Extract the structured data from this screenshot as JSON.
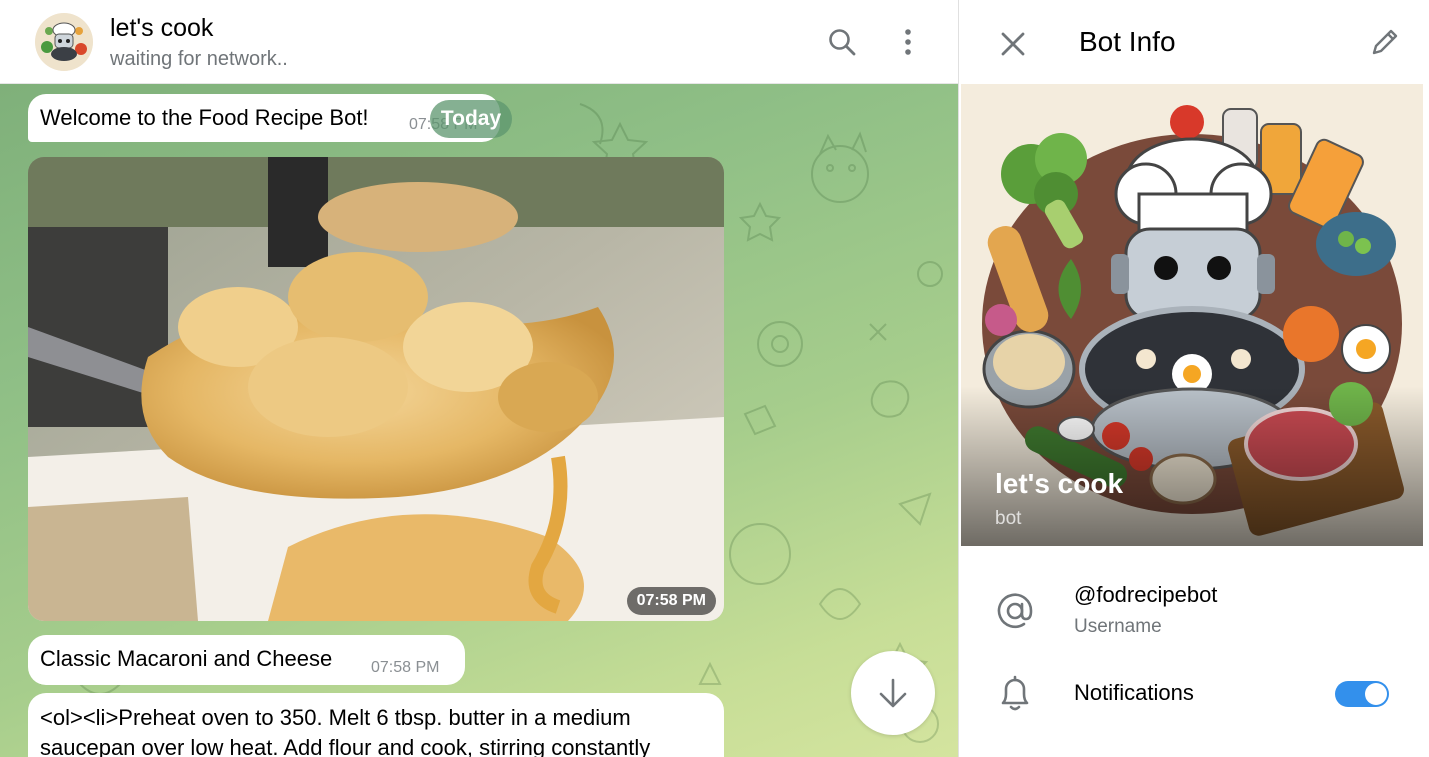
{
  "chat": {
    "title": "let's cook",
    "status": "waiting for network..",
    "date_badge": "Today",
    "messages": [
      {
        "text": "Welcome to the Food Recipe Bot!",
        "time": "07:58 PM"
      },
      {
        "type": "photo",
        "time": "07:58 PM"
      },
      {
        "text": "Classic Macaroni and Cheese",
        "time": "07:58 PM"
      },
      {
        "text_line1": "<ol><li>Preheat oven to 350. Melt 6 tbsp. butter in a medium",
        "text_line2": "saucepan over low heat. Add flour and cook, stirring constantly"
      }
    ]
  },
  "header_icons": [
    "search-icon",
    "more-vertical-icon"
  ],
  "bot_info": {
    "title": "Bot Info",
    "name": "let's cook",
    "subtitle": "bot",
    "username": "@fodrecipebot",
    "username_label": "Username",
    "notifications_label": "Notifications",
    "notifications_on": true
  },
  "colors": {
    "accent": "#3390ec",
    "chat_bg_top": "#7fb07a",
    "chat_bg_bottom": "#d4e49f",
    "secondary_text": "#707579"
  }
}
